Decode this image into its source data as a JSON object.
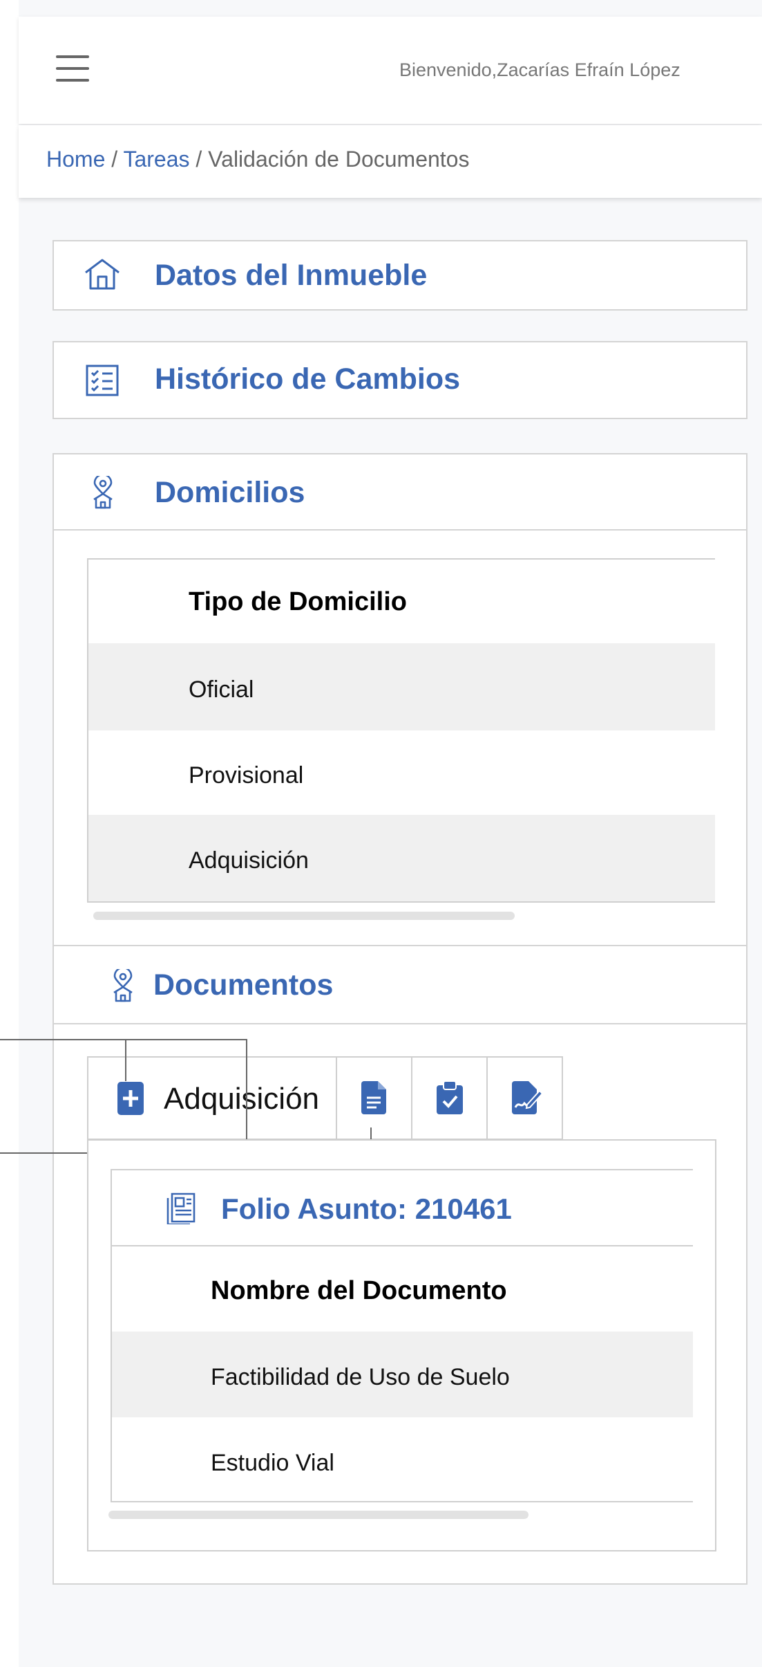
{
  "header": {
    "menu_icon": "hamburger-menu-icon",
    "welcome_text": "Bienvenido,Zacarías Efraín López"
  },
  "breadcrumb": {
    "home": "Home",
    "sep1": " / ",
    "tareas": "Tareas",
    "sep2": " / ",
    "current": "Validación de Documentos"
  },
  "sections": {
    "inmueble": {
      "title": "Datos del Inmueble",
      "icon": "house-icon"
    },
    "historico": {
      "title": "Histórico de Cambios",
      "icon": "checklist-icon"
    },
    "domicilios": {
      "title": "Domicilios",
      "icon": "location-house-icon"
    },
    "documentos": {
      "title": "Documentos",
      "icon": "location-house-icon"
    }
  },
  "domicilios_table": {
    "header": "Tipo de Domicilio",
    "rows": [
      "Oficial",
      "Provisional",
      "Adquisición"
    ]
  },
  "documentos_tabs": {
    "active_label": "Adquisición",
    "icons": [
      "plus-square-icon",
      "document-icon",
      "clipboard-check-icon",
      "signature-document-icon"
    ]
  },
  "folio": {
    "title": "Folio Asunto: 210461",
    "icon": "folio-document-icon",
    "header": "Nombre del Documento",
    "rows": [
      "Factibilidad de Uso de Suelo",
      "Estudio Vial"
    ]
  },
  "colors": {
    "accent": "#3a67b3",
    "text": "#111111",
    "muted": "#777777",
    "border": "#d4d4d4",
    "row_alt": "#f0f0f0",
    "page_bg": "#f7f8fa"
  }
}
